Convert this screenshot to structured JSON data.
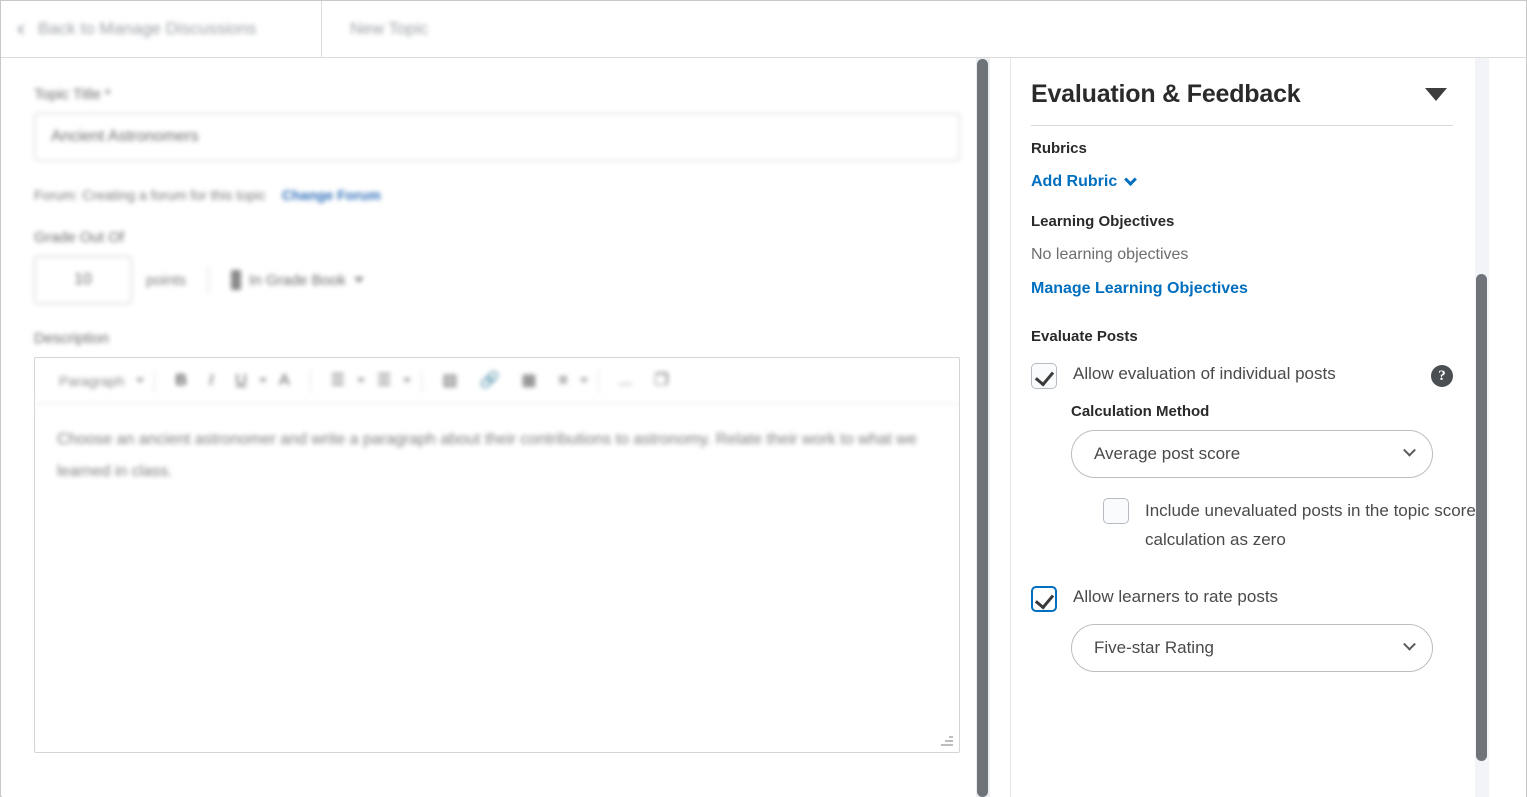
{
  "tabbar": {
    "back_tab": "Back to Manage Discussions",
    "back_icon": "chevron-left-icon",
    "new_topic_tab": "New Topic"
  },
  "main": {
    "topic_title_label": "Topic Title *",
    "topic_title_value": "Ancient Astronomers",
    "forum_text": "Forum: Creating a forum for this topic",
    "change_forum_link": "Change Forum",
    "grade_out_of_label": "Grade Out Of",
    "grade_value": "10",
    "points_label": "points",
    "gradebook_label": "In Grade Book",
    "description_label": "Description",
    "toolbar": {
      "paragraph_style": "Paragraph",
      "bold": "B",
      "italic": "I",
      "underline": "U",
      "text_color": "A",
      "align": "align-left-icon",
      "list": "list-icon",
      "insert_stuff": "insert-stuff-icon",
      "insert_quicklink": "quicklink-icon",
      "insert_image": "image-icon",
      "insert_equation": "equation-icon",
      "more": "...",
      "fullscreen": "fullscreen-icon"
    },
    "description_text": "Choose an ancient astronomer and write a paragraph about their contributions to astronomy. Relate their work to what we learned in class."
  },
  "right_panel": {
    "title": "Evaluation & Feedback",
    "collapse_icon": "caret-down-icon",
    "rubrics_label": "Rubrics",
    "add_rubric_link": "Add Rubric",
    "learning_objectives_label": "Learning Objectives",
    "no_learning_objectives": "No learning objectives",
    "manage_learning_objectives_link": "Manage Learning Objectives",
    "evaluate_posts_label": "Evaluate Posts",
    "allow_evaluation_label": "Allow evaluation of individual posts",
    "allow_evaluation_checked": true,
    "help_icon": "?",
    "calculation_method_label": "Calculation Method",
    "calculation_method_value": "Average post score",
    "include_unevaluated_label": "Include unevaluated posts in the topic score calculation as zero",
    "include_unevaluated_checked": false,
    "allow_rate_posts_label": "Allow learners to rate posts",
    "allow_rate_posts_checked": true,
    "rating_value": "Five-star Rating"
  },
  "colors": {
    "link_blue": "#006fbf",
    "scrollbar_thumb": "#6e7479",
    "text_primary": "#2a2a2a"
  }
}
